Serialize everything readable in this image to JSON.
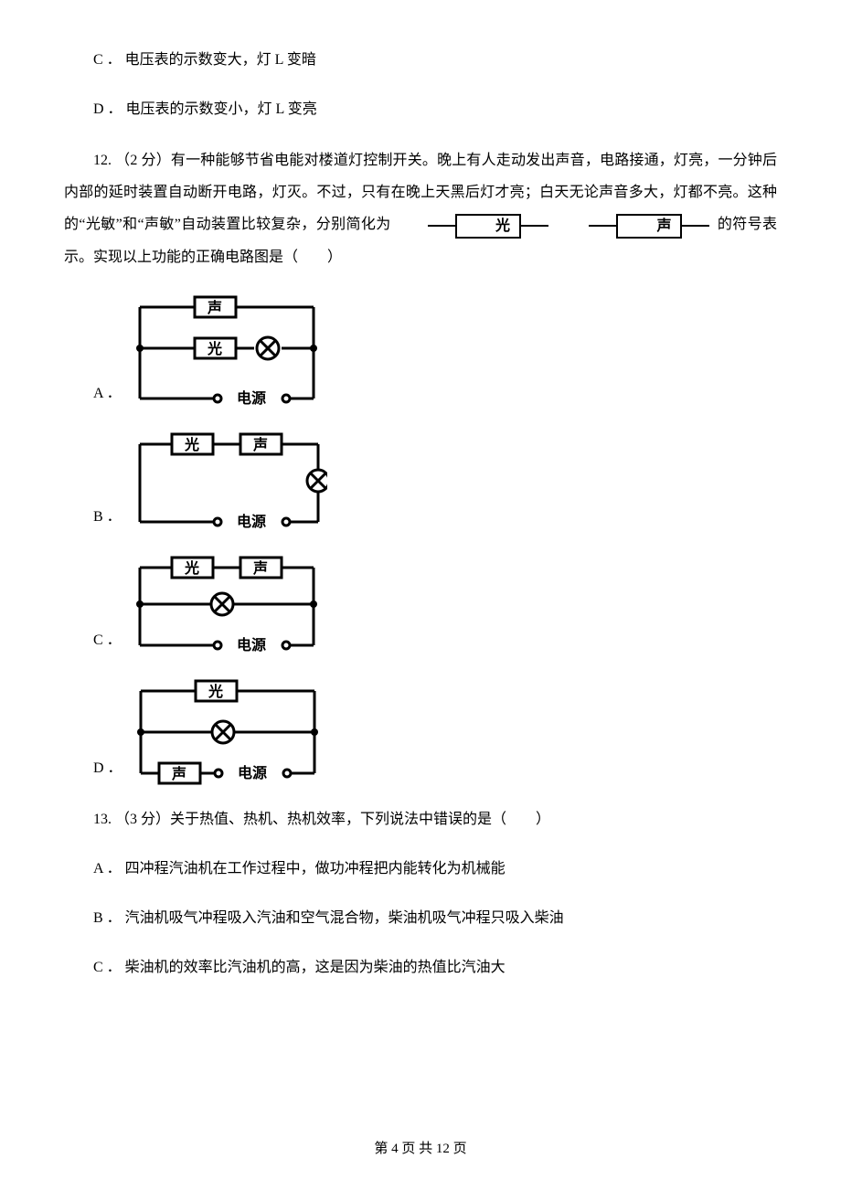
{
  "q11_options": {
    "c": "C ． 电压表的示数变大，灯 L 变暗",
    "d": "D ． 电压表的示数变小，灯 L 变亮"
  },
  "q12": {
    "prefix": "12. （2 分）有一种能够节省电能对楼道灯控制开关。晚上有人走动发出声音，电路接通，灯亮，一分钟后内部的延时装置自动断开电路，灯灭。不过，只有在晚上天黑后灯才亮；白天无论声音多大，灯都不亮。这种的“光敏”和“声敏”自动装置比较复杂，分别简化为",
    "suffix": "的符号表示。实现以上功能的正确电路图是（　　）",
    "symbol_light": "光",
    "symbol_sound": "声",
    "options": {
      "a": "A ．",
      "b": "B ．",
      "c": "C ．",
      "d": "D ．"
    },
    "labels": {
      "sound": "声",
      "light": "光",
      "power": "电源"
    }
  },
  "q13": {
    "stem": "13. （3 分）关于热值、热机、热机效率，下列说法中错误的是（　　）",
    "a": "A ． 四冲程汽油机在工作过程中，做功冲程把内能转化为机械能",
    "b": "B ． 汽油机吸气冲程吸入汽油和空气混合物，柴油机吸气冲程只吸入柴油",
    "c": "C ． 柴油机的效率比汽油机的高，这是因为柴油的热值比汽油大"
  },
  "footer": "第 4 页 共 12 页"
}
